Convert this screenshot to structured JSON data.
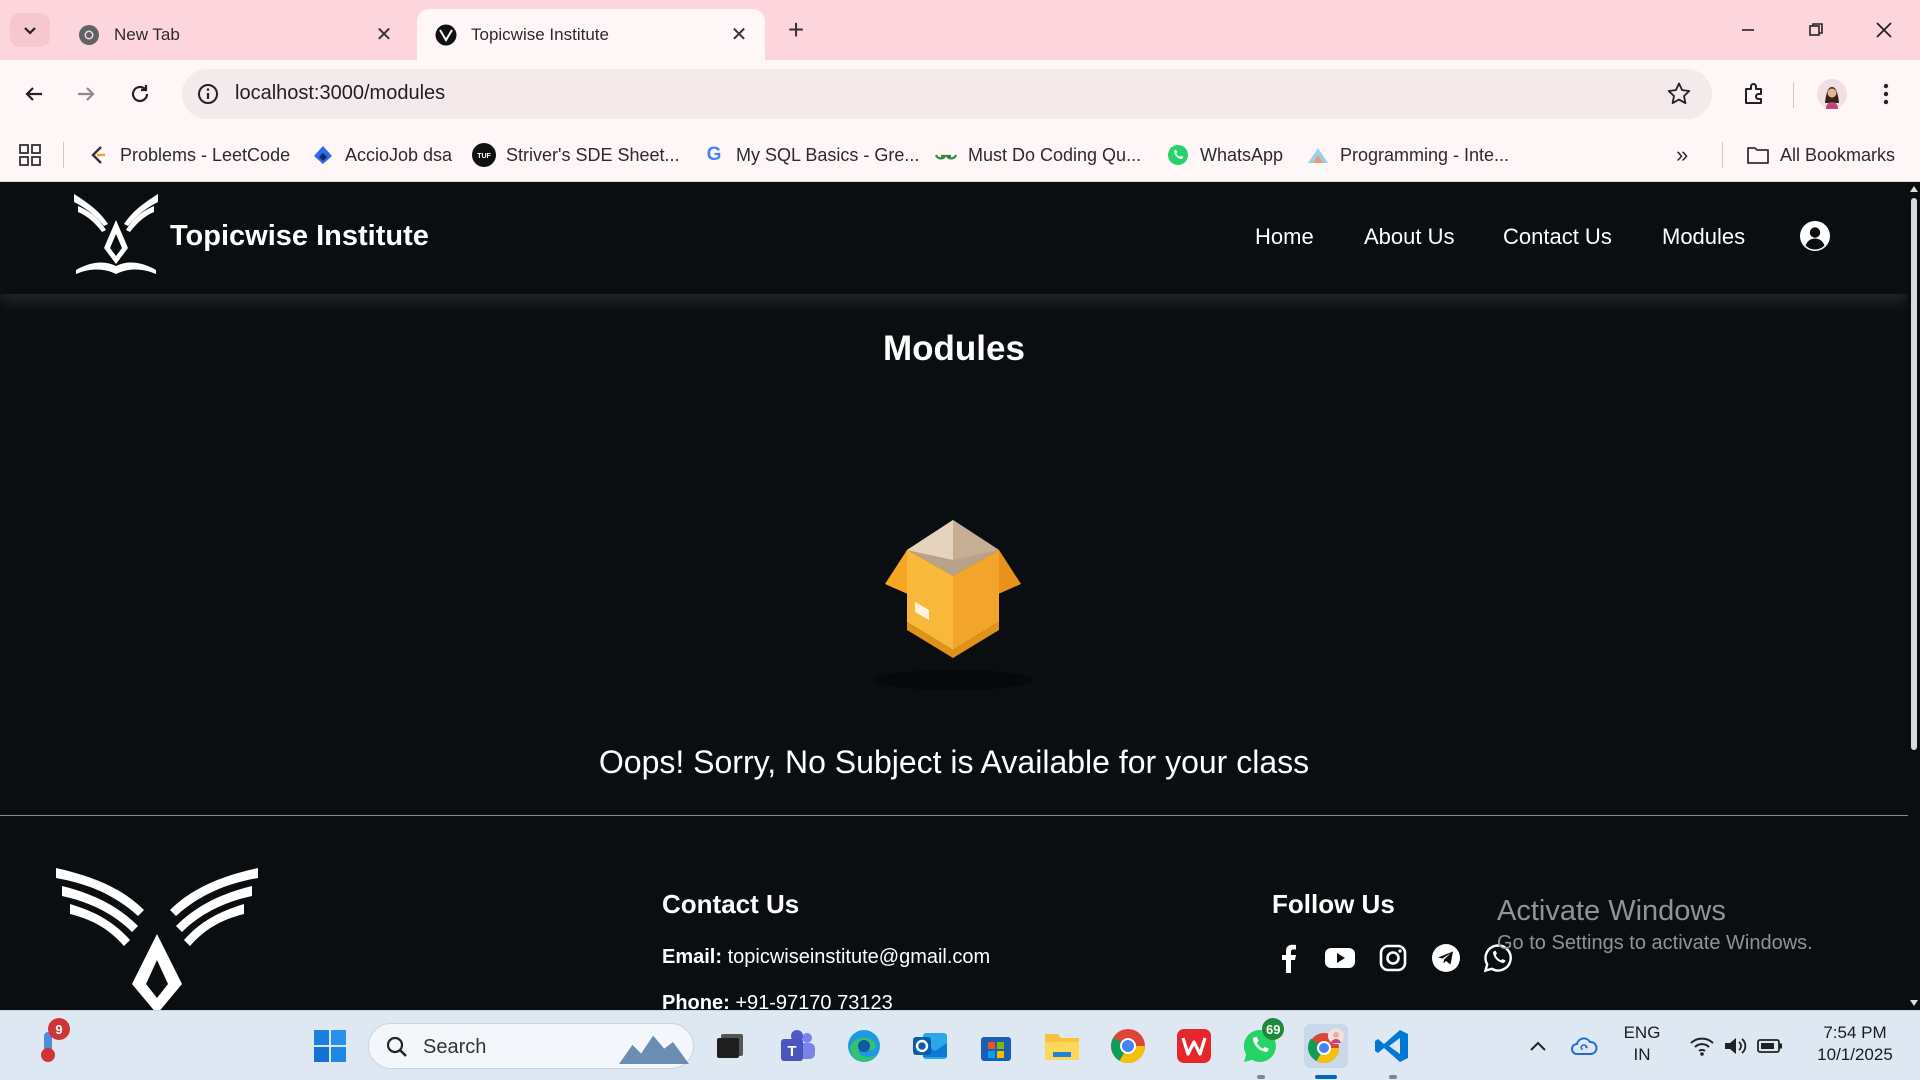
{
  "browser": {
    "tabs": [
      {
        "title": "New Tab",
        "active": false
      },
      {
        "title": "Topicwise Institute",
        "active": true
      }
    ],
    "url": "localhost:3000/modules",
    "bookmarks": [
      {
        "label": "Problems - LeetCode"
      },
      {
        "label": "AccioJob dsa"
      },
      {
        "label": "Striver's SDE Sheet..."
      },
      {
        "label": "My SQL Basics - Gre..."
      },
      {
        "label": "Must Do Coding Qu..."
      },
      {
        "label": "WhatsApp"
      },
      {
        "label": "Programming - Inte..."
      }
    ],
    "all_bookmarks": "All Bookmarks"
  },
  "site": {
    "brand": "Topicwise Institute",
    "nav": [
      {
        "label": "Home"
      },
      {
        "label": "About Us"
      },
      {
        "label": "Contact Us"
      },
      {
        "label": "Modules"
      }
    ]
  },
  "main": {
    "title": "Modules",
    "empty_message": "Oops! Sorry, No Subject is Available for your class"
  },
  "footer": {
    "contact_heading": "Contact Us",
    "email_label": "Email:",
    "email_value": "topicwiseinstitute@gmail.com",
    "phone_label": "Phone:",
    "phone_value": "+91-97170 73123",
    "follow_heading": "Follow Us",
    "social": [
      "facebook-icon",
      "youtube-icon",
      "instagram-icon",
      "telegram-icon",
      "whatsapp-icon"
    ]
  },
  "watermark": {
    "line1": "Activate Windows",
    "line2": "Go to Settings to activate Windows."
  },
  "taskbar": {
    "weather_badge": "9",
    "search_label": "Search",
    "whatsapp_badge": "69",
    "language": "ENG",
    "region": "IN",
    "time": "7:54 PM",
    "date": "10/1/2025"
  },
  "colors": {
    "tab_strip": "#fcd6dc",
    "toolbar": "#fff6f7",
    "page_bg": "#0b0e11",
    "box_orange": "#f5a623"
  }
}
